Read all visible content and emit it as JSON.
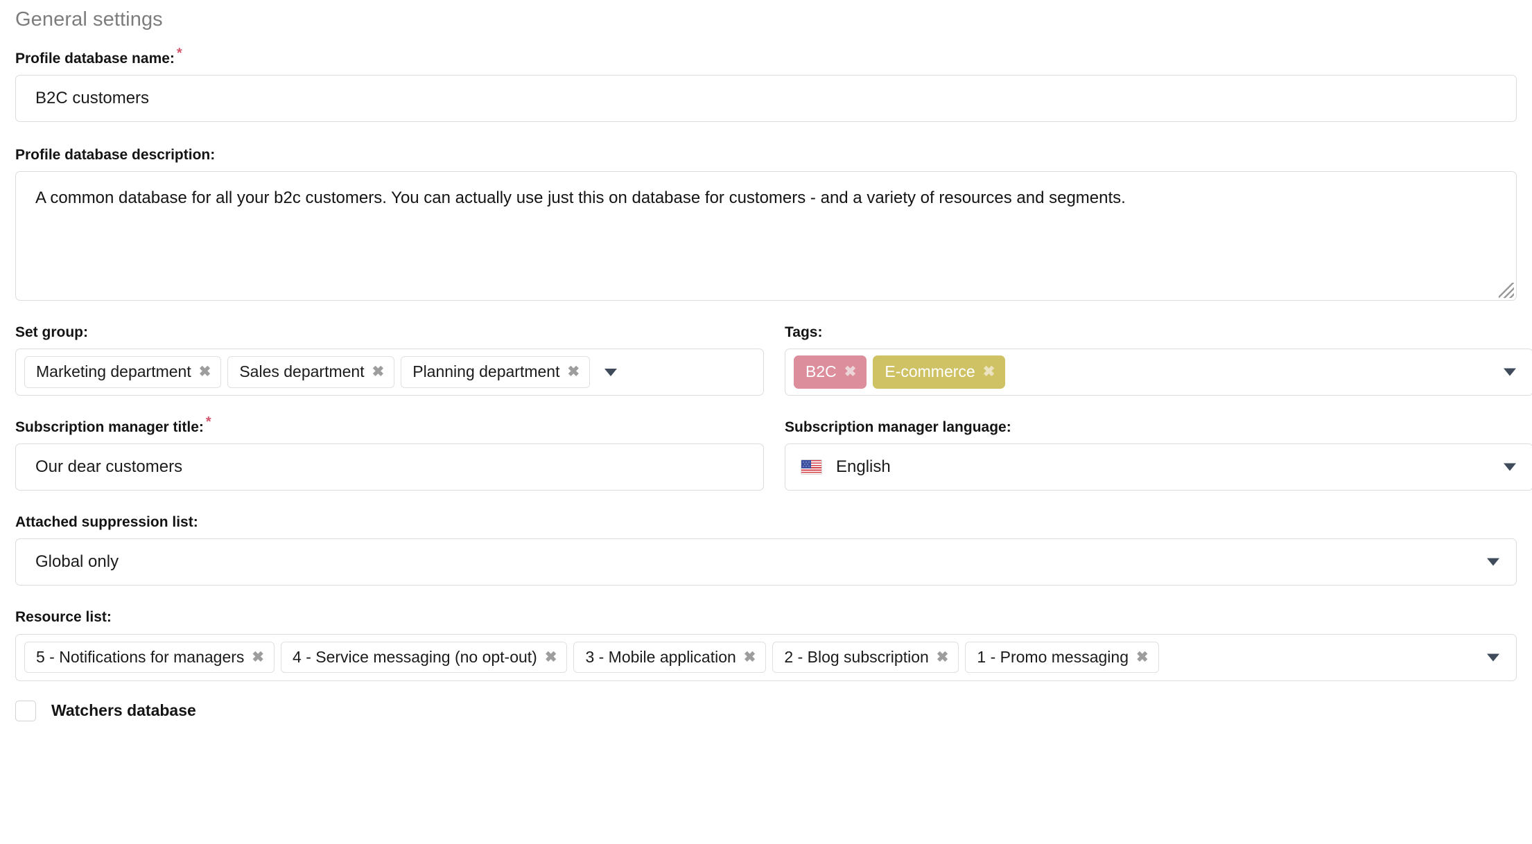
{
  "section": {
    "title": "General settings"
  },
  "fields": {
    "profile_name": {
      "label": "Profile database name:",
      "required_marker": "*",
      "value": "B2C customers"
    },
    "profile_description": {
      "label": "Profile database description:",
      "value": "A common database for all your b2c customers. You can actually use just this on database for customers - and a variety of resources and segments."
    },
    "set_group": {
      "label": "Set group:",
      "chips": [
        "Marketing department",
        "Sales department",
        "Planning department"
      ]
    },
    "tags": {
      "label": "Tags:",
      "chips": [
        {
          "label": "B2C",
          "color": "#dd8e9c"
        },
        {
          "label": "E-commerce",
          "color": "#cfc265"
        }
      ]
    },
    "sm_title": {
      "label": "Subscription manager title:",
      "required_marker": "*",
      "value": "Our dear customers"
    },
    "sm_language": {
      "label": "Subscription manager language:",
      "value": "English",
      "flag": "us-flag-icon"
    },
    "suppression_list": {
      "label": "Attached suppression list:",
      "value": "Global only"
    },
    "resource_list": {
      "label": "Resource list:",
      "chips": [
        "5 - Notifications for managers",
        "4 - Service messaging (no opt-out)",
        "3 - Mobile application",
        "2 - Blog subscription",
        "1 - Promo messaging"
      ]
    },
    "watchers": {
      "label": "Watchers database",
      "checked": false
    }
  },
  "icons": {
    "chip_remove": "✖",
    "dropdown_caret": "▼"
  },
  "colors": {
    "required": "#d2576e",
    "heading": "#7d7d7d",
    "border": "#dcdcdc",
    "tag_pink": "#dd8e9c",
    "tag_khaki": "#cfc265"
  }
}
